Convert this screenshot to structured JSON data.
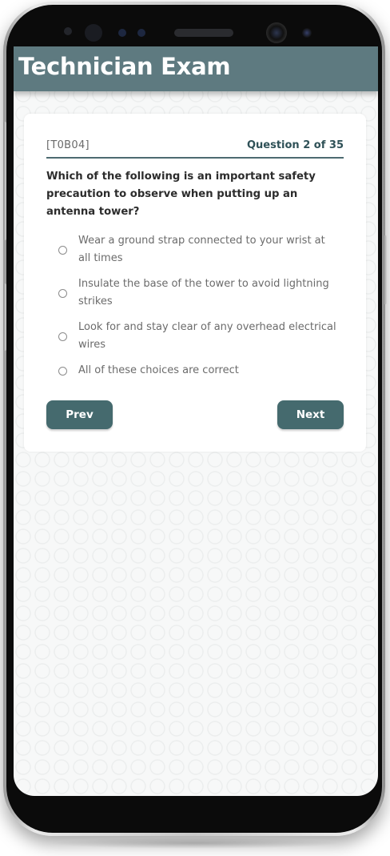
{
  "app": {
    "title": "Technician Exam"
  },
  "question": {
    "code": "[T0B04]",
    "counter": "Question 2 of 35",
    "text": "Which of the following is an important safety precaution to observe when putting up an antenna tower?",
    "choices": [
      {
        "label": "Wear a ground strap connected to your wrist at all times",
        "selected": false
      },
      {
        "label": "Insulate the base of the tower to avoid lightning strikes",
        "selected": false
      },
      {
        "label": "Look for and stay clear of any overhead electrical wires",
        "selected": false
      },
      {
        "label": "All of these choices are correct",
        "selected": false
      }
    ]
  },
  "nav": {
    "prev_label": "Prev",
    "next_label": "Next"
  },
  "colors": {
    "header": "#5e7a80",
    "accent": "#456a6e",
    "counter_text": "#2f5157"
  }
}
